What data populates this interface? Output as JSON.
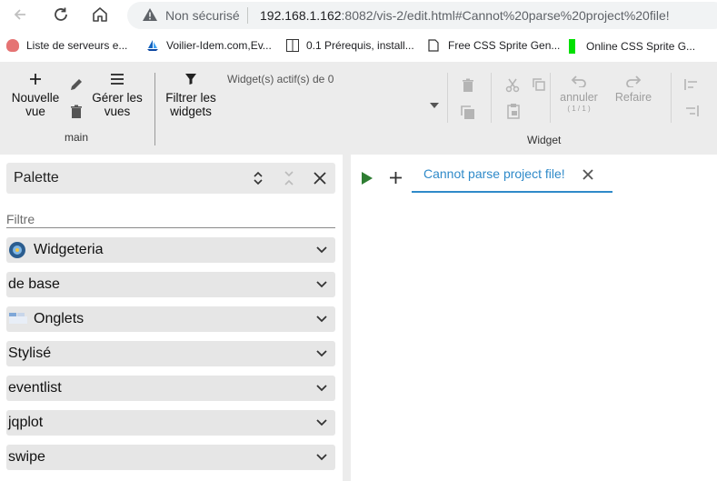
{
  "browser": {
    "security_label": "Non sécurisé",
    "url_host": "192.168.1.162",
    "url_rest": ":8082/vis-2/edit.html#Cannot%20parse%20project%20file!"
  },
  "bookmarks": [
    {
      "label": "Liste de serveurs e...",
      "icon": "pig-icon"
    },
    {
      "label": "Voilier-Idem.com,Ev...",
      "icon": "sailboat-icon"
    },
    {
      "label": "0.1 Prérequis, install...",
      "icon": "book-icon"
    },
    {
      "label": "Free CSS Sprite Gen...",
      "icon": "page-icon"
    },
    {
      "label": "Online CSS Sprite G...",
      "icon": "green-bar-icon"
    }
  ],
  "ribbon": {
    "new_view_line1": "Nouvelle",
    "new_view_line2": "vue",
    "manage_views_line1": "Gérer les",
    "manage_views_line2": "vues",
    "group_main": "main",
    "filter_widgets_line1": "Filtrer les",
    "filter_widgets_line2": "widgets",
    "active_widgets": "Widget(s) actif(s) de 0",
    "undo_label": "annuler",
    "undo_count": "( 1 / 1 )",
    "redo_label": "Refaire",
    "group_widget": "Widget"
  },
  "palette": {
    "title": "Palette",
    "filter_label": "Filtre",
    "items": [
      {
        "label": "Widgeteria",
        "icon": "widgeteria-icon"
      },
      {
        "label": "de base",
        "icon": ""
      },
      {
        "label": "Onglets",
        "icon": "tabs-icon"
      },
      {
        "label": "Stylisé",
        "icon": ""
      },
      {
        "label": "eventlist",
        "icon": ""
      },
      {
        "label": "jqplot",
        "icon": ""
      },
      {
        "label": "swipe",
        "icon": ""
      }
    ]
  },
  "main": {
    "tab_label": "Cannot parse project file!"
  },
  "colors": {
    "accent": "#2f8ac9",
    "play": "#2e7d32",
    "toolbar_bg": "#ececec"
  }
}
